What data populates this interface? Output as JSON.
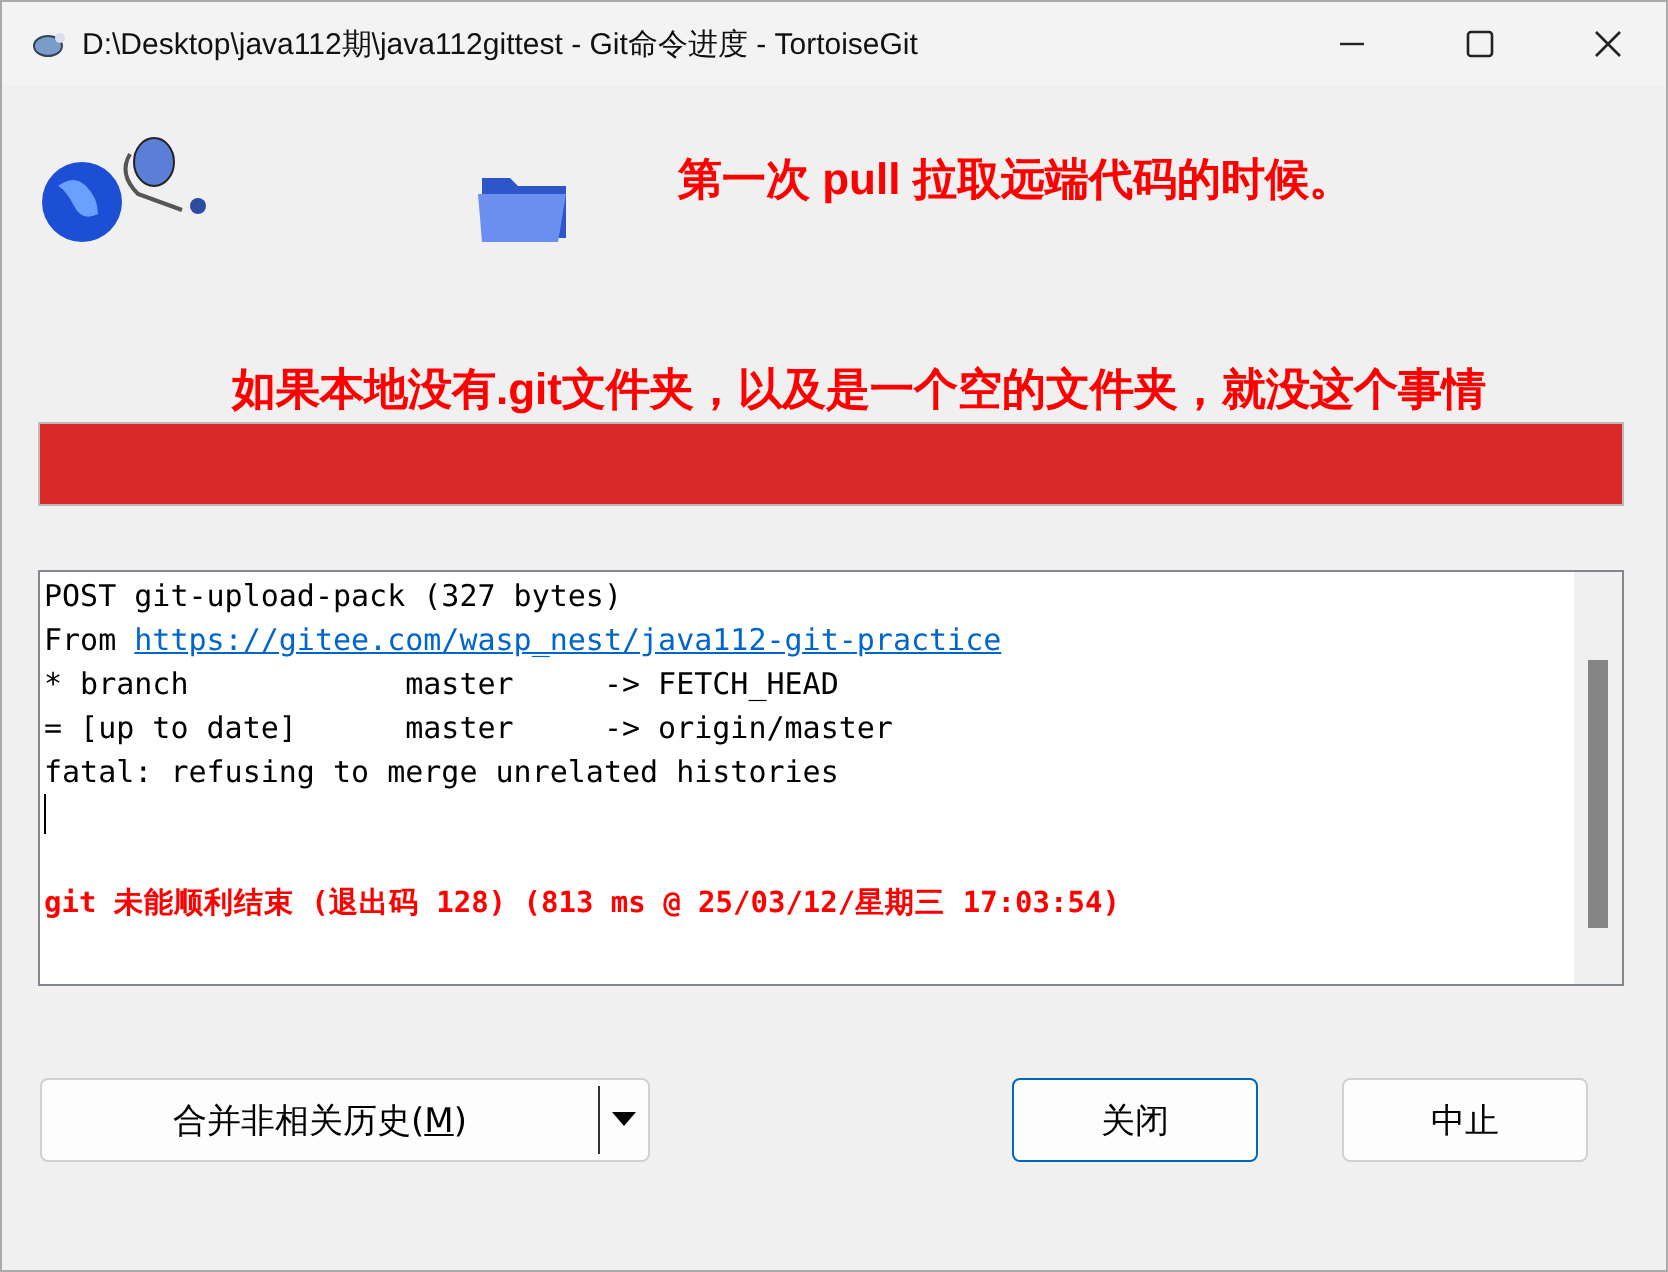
{
  "window": {
    "title": "D:\\Desktop\\java112期\\java112gittest - Git命令进度 - TortoiseGit"
  },
  "annotations": [
    "第一次 pull 拉取远端代码的时候。",
    "如果本地没有.git文件夹，以及是一个空的文件夹，就没这个事情"
  ],
  "progress": {
    "level": 1,
    "failed": true
  },
  "log": {
    "lines": [
      {
        "kind": "plain",
        "text": "POST git-upload-pack (327 bytes)"
      },
      {
        "kind": "link",
        "text": "From ",
        "link": "https://gitee.com/wasp_nest/java112-git-practice"
      },
      {
        "kind": "plain",
        "text": "* branch            master     -> FETCH_HEAD"
      },
      {
        "kind": "plain",
        "text": "= [up to date]      master     -> origin/master"
      },
      {
        "kind": "plain",
        "text": "fatal: refusing to merge unrelated histories"
      },
      {
        "kind": "cursor"
      },
      {
        "kind": "error",
        "text": "git 未能顺利结束 (退出码 128) (813 ms @ 25/03/12/星期三 17:03:54)"
      }
    ]
  },
  "buttons": [
    {
      "label": "合并非相关历史(",
      "key": "M",
      "suffix": ")",
      "kind": "split",
      "focused": false
    },
    {
      "label": "关闭",
      "kind": "plain",
      "focused": true
    },
    {
      "label": "中止",
      "kind": "plain",
      "focused": false
    }
  ]
}
